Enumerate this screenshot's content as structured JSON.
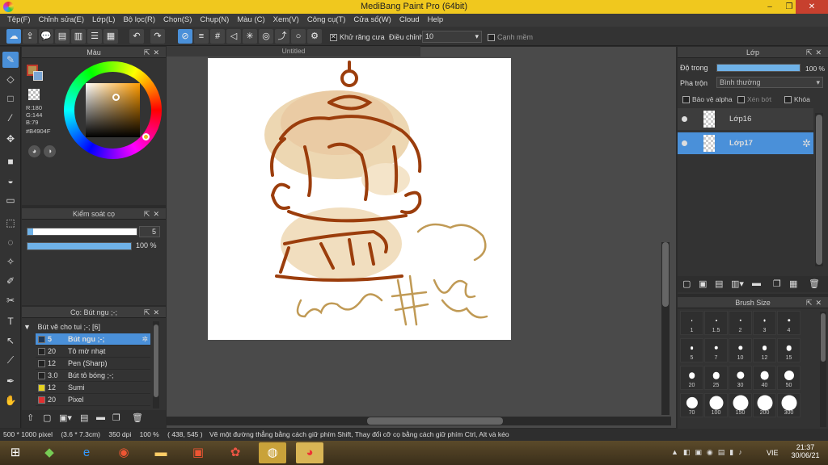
{
  "window": {
    "title": "MediBang Paint Pro (64bit)",
    "minimize": "–",
    "restore": "❐",
    "close": "✕"
  },
  "menu": [
    "Tệp(F)",
    "Chỉnh sửa(E)",
    "Lớp(L)",
    "Bộ lọc(R)",
    "Chọn(S)",
    "Chụp(N)",
    "Màu (C)",
    "Xem(V)",
    "Công cụ(T)",
    "Cửa sổ(W)",
    "Cloud",
    "Help"
  ],
  "toolbar": {
    "antialias_label": "Khử răng cưa",
    "correction_label": "Điều chỉnh",
    "correction_value": "10",
    "edge_label": "Cạnh mềm"
  },
  "color_panel": {
    "title": "Màu",
    "r": "R:180",
    "g": "G:144",
    "b": "B:79",
    "hex": "#B4904F",
    "main_color": "#b4904f",
    "secondary_color": "#7aa6d6"
  },
  "brush_control": {
    "title": "Kiểm soát cọ",
    "size": "5",
    "size_fraction": 0.05,
    "opacity": "100 %",
    "opacity_fraction": 1.0
  },
  "brush_panel": {
    "title": "Cọ: Bút ngu ;-;",
    "group": "Bút vẽ cho tui ;-; [6]",
    "items": [
      {
        "size": "5",
        "name": "Bút ngu ;-;",
        "color": "#1f3a5a",
        "selected": true
      },
      {
        "size": "20",
        "name": "Tô mờ nhạt",
        "color": "#222222",
        "selected": false
      },
      {
        "size": "12",
        "name": "Pen (Sharp)",
        "color": "#222222",
        "selected": false
      },
      {
        "size": "3.0",
        "name": "Bút tô bóng ;-;",
        "color": "#222222",
        "selected": false
      },
      {
        "size": "12",
        "name": "Sumi",
        "color": "#e6d21e",
        "selected": false
      },
      {
        "size": "20",
        "name": "Pixel",
        "color": "#e03030",
        "selected": false
      }
    ]
  },
  "document": {
    "tab_title": "Untitled"
  },
  "layer_panel": {
    "title": "Lớp",
    "opacity_label": "Độ trong",
    "opacity_value": "100 %",
    "opacity_fraction": 1.0,
    "blend_label": "Pha trộn",
    "blend_value": "Bình thường",
    "protect_alpha": "Bảo vệ alpha",
    "clipping": "Xén bớt",
    "lock": "Khóa",
    "layers": [
      {
        "name": "Lớp16",
        "selected": false
      },
      {
        "name": "Lớp17",
        "selected": true
      }
    ]
  },
  "brush_size_panel": {
    "title": "Brush Size",
    "sizes": [
      "1",
      "1.5",
      "2",
      "3",
      "4",
      "5",
      "7",
      "10",
      "12",
      "15",
      "20",
      "25",
      "30",
      "40",
      "50",
      "70",
      "100",
      "150",
      "200",
      "300"
    ]
  },
  "status": {
    "dimensions": "500 * 1000 pixel",
    "physical": "(3.6 * 7.3cm)",
    "dpi": "350 dpi",
    "zoom": "100 %",
    "coords": "( 438, 545 )",
    "hint": "Vẽ một đường thẳng bằng cách giữ phím Shift, Thay đổi cỡ cọ bằng cách giữ phím Ctrl, Alt và kéo"
  },
  "taskbar": {
    "lang": "VIE",
    "time": "21:37",
    "date": "30/06/21"
  }
}
